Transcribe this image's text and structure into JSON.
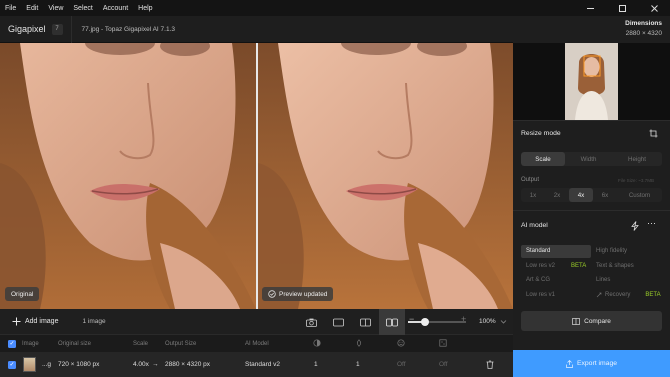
{
  "menubar": {
    "items": [
      "File",
      "Edit",
      "View",
      "Select",
      "Account",
      "Help"
    ]
  },
  "titlebar": {
    "app_name": "Gigapixel",
    "version_badge": "7",
    "file_title": "77.jpg - Topaz Gigapixel AI 7.1.3"
  },
  "dimensions": {
    "title": "Dimensions",
    "value": "2880 × 4320"
  },
  "preview": {
    "left_label": "Original",
    "right_label": "Preview updated"
  },
  "toolbar": {
    "add_image": "Add image",
    "image_count": "1 image",
    "zoom_value": "100%",
    "zoom_level": 0.3
  },
  "table": {
    "headers": [
      "Image",
      "Original size",
      "Scale",
      "Output Size",
      "AI Model"
    ],
    "row": {
      "name": "...g",
      "original_size": "720 × 1080 px",
      "scale": "4.00x",
      "arrow": "→",
      "output_size": "2880 × 4320 px",
      "model": "Standard v2",
      "c1": "1",
      "c2": "1",
      "c3": "Off",
      "c4": "Off"
    }
  },
  "resize": {
    "title": "Resize mode",
    "modes": [
      "Scale",
      "Width",
      "Height"
    ],
    "output_label": "Output",
    "file_size": "File Size: ~3.7MB",
    "scales": [
      "1x",
      "2x",
      "4x",
      "6x",
      "Custom"
    ]
  },
  "ai_model": {
    "title": "AI model",
    "rows": [
      {
        "left": "Standard",
        "right": "High fidelity",
        "left_beta": "",
        "right_beta": ""
      },
      {
        "left": "Low res v2",
        "right": "Text & shapes",
        "left_beta": "BETA",
        "right_beta": ""
      },
      {
        "left": "Art & CG",
        "right": "Lines",
        "left_beta": "",
        "right_beta": ""
      },
      {
        "left": "Low res v1",
        "right": "Recovery",
        "left_beta": "",
        "right_beta": "BETA"
      }
    ]
  },
  "actions": {
    "compare": "Compare",
    "export": "Export image"
  },
  "colors": {
    "accent": "#3f9bff",
    "beta": "#9ccf28"
  }
}
